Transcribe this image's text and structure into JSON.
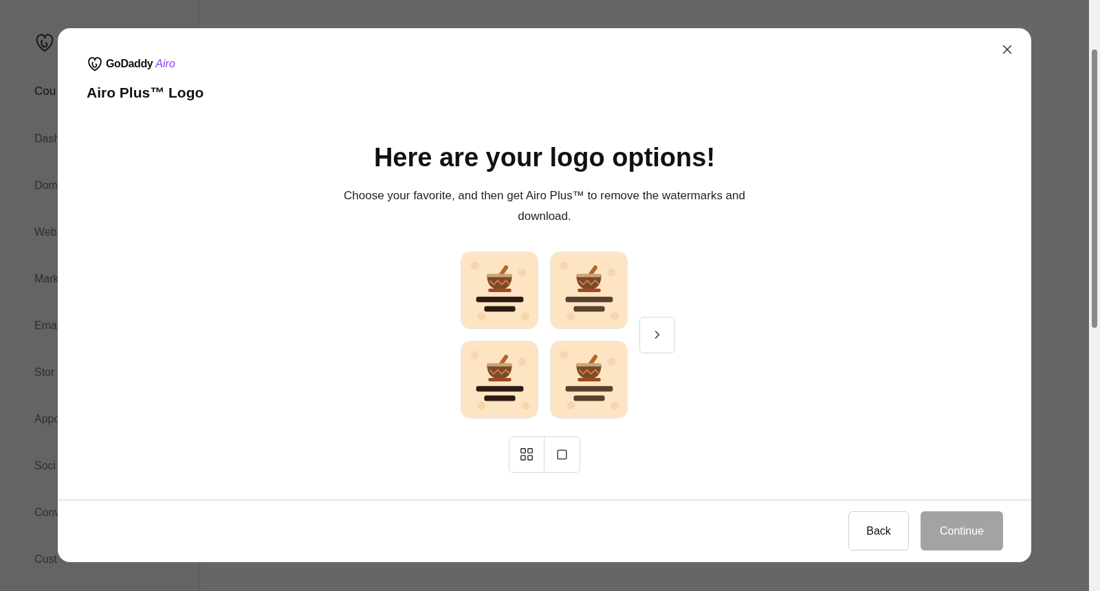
{
  "background": {
    "sidebar": {
      "heading": "Cou",
      "items": [
        "Dash",
        "Dom",
        "Web",
        "Mark",
        "Ema",
        "Stor",
        "Appo",
        "Soci",
        "Conv",
        "Cust"
      ]
    }
  },
  "modal": {
    "brand": {
      "name": "GoDaddy",
      "product": "Airo"
    },
    "title": "Airo Plus™ Logo",
    "heading": "Here are your logo options!",
    "description": "Choose your favorite, and then get Airo Plus™ to remove the watermarks and download.",
    "footer": {
      "back": "Back",
      "continue": {
        "label": "Continue",
        "disabled": true
      }
    }
  }
}
